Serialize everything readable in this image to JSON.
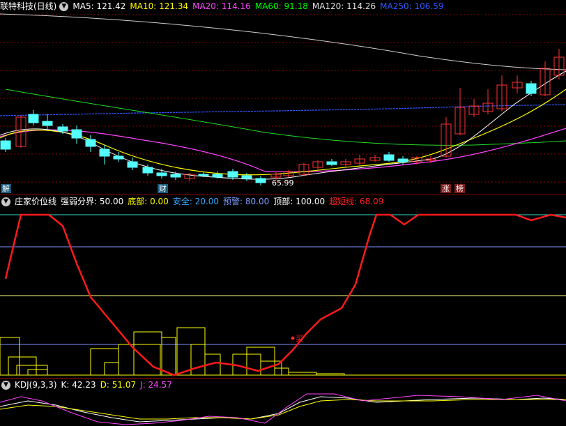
{
  "main_pane": {
    "title": "联特科技(日线)",
    "ma": [
      {
        "label": "MA5: 121.42",
        "color": "#ffffff"
      },
      {
        "label": "MA10: 121.34",
        "color": "#ffff00"
      },
      {
        "label": "MA20: 114.16",
        "color": "#ff44ff"
      },
      {
        "label": "MA60: 91.18",
        "color": "#00ff00"
      },
      {
        "label": "MA120: 114.26",
        "color": "#e0e0e0"
      },
      {
        "label": "MA250: 106.59",
        "color": "#3355ff"
      }
    ],
    "low_label": "65.99",
    "badges": [
      "解",
      "财",
      "涨",
      "榜"
    ]
  },
  "indicator_pane": {
    "title": "庄家价位线",
    "items": [
      {
        "label": "强弱分界: 50.00",
        "color": "#ffffff"
      },
      {
        "label": "底部: 0.00",
        "color": "#ffff00"
      },
      {
        "label": "安全: 20.00",
        "color": "#33aaff"
      },
      {
        "label": "预警: 80.00",
        "color": "#7f9fff"
      },
      {
        "label": "顶部: 100.00",
        "color": "#ffffff"
      },
      {
        "label": "超短线: 68.09",
        "color": "#ff2020"
      }
    ],
    "buy_label": "买"
  },
  "kdj_pane": {
    "title": "KDJ(9,3,3)",
    "items": [
      {
        "label": "K: 42.23",
        "color": "#ffffff"
      },
      {
        "label": "D: 51.07",
        "color": "#ffff00"
      },
      {
        "label": "J: 24.57",
        "color": "#ff44ff"
      }
    ]
  },
  "colors": {
    "up": "#ff3232",
    "down": "#54ffff",
    "grid": "#8a0000"
  }
}
